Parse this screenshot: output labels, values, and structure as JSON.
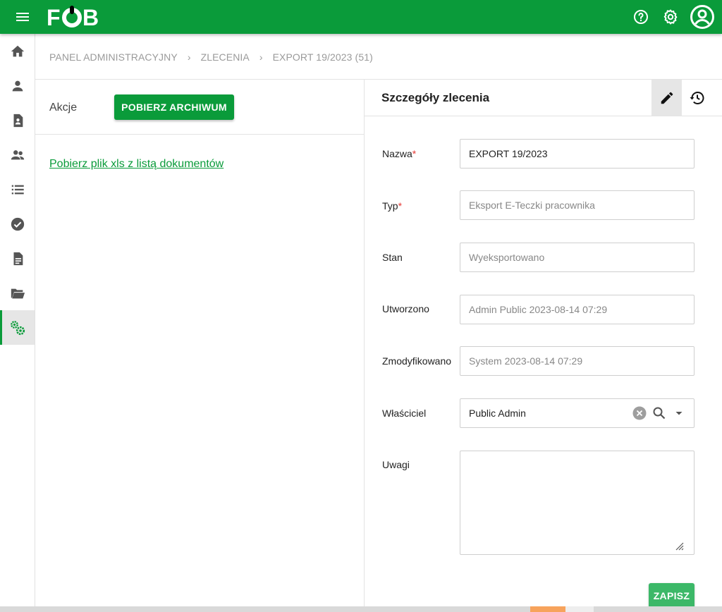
{
  "app": {
    "logo_text": "FOB",
    "brand_color": "#0a9b3a"
  },
  "topbar": {
    "menu_icon": "hamburger-menu-icon",
    "icons": [
      "help-circle-icon",
      "settings-gear-icon",
      "account-circle-icon"
    ]
  },
  "sidebar": {
    "items": [
      {
        "icon": "home-icon"
      },
      {
        "icon": "person-icon"
      },
      {
        "icon": "person-document-icon"
      },
      {
        "icon": "people-icon"
      },
      {
        "icon": "list-icon"
      },
      {
        "icon": "check-circle-icon"
      },
      {
        "icon": "document-icon"
      },
      {
        "icon": "folder-open-icon"
      },
      {
        "icon": "cogs-icon",
        "active": true
      }
    ]
  },
  "breadcrumb": {
    "items": [
      "PANEL ADMINISTRACYJNY",
      "ZLECENIA",
      "EXPORT 19/2023 (51)"
    ]
  },
  "left": {
    "actions_label": "Akcje",
    "archive_button": "POBIERZ ARCHIWUM",
    "xls_link": "Pobierz plik xls z listą dokumentów"
  },
  "details": {
    "title": "Szczegóły zlecenia",
    "fields": {
      "nazwa": {
        "label": "Nazwa",
        "required_mark": "*",
        "value": "EXPORT 19/2023"
      },
      "typ": {
        "label": "Typ",
        "required_mark": "*",
        "value": "Eksport E-Teczki pracownika"
      },
      "stan": {
        "label": "Stan",
        "value": "Wyeksportowano"
      },
      "utworzono": {
        "label": "Utworzono",
        "value": "Admin Public 2023-08-14 07:29"
      },
      "zmodyfikowano": {
        "label": "Zmodyfikowano",
        "value": "System 2023-08-14 07:29"
      },
      "wlasciciel": {
        "label": "Właściciel",
        "value": "Public Admin"
      },
      "uwagi": {
        "label": "Uwagi",
        "value": ""
      }
    },
    "save_button": "ZAPISZ"
  }
}
